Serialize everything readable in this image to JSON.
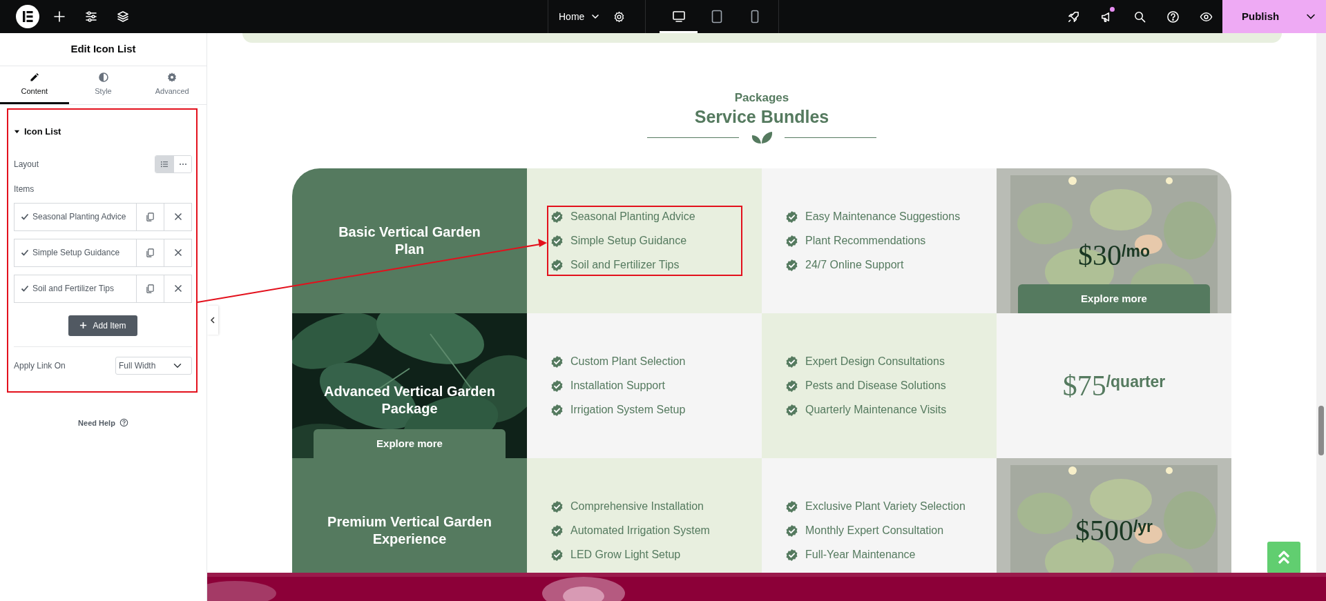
{
  "topbar": {
    "page": "Home",
    "devices": [
      {
        "selected": true
      },
      {
        "selected": false
      },
      {
        "selected": false
      }
    ],
    "has_updates": true,
    "publish": "Publish"
  },
  "panel": {
    "title": "Edit Icon List",
    "tabs": [
      {
        "label": "Content",
        "selected": true
      },
      {
        "label": "Style",
        "selected": false
      },
      {
        "label": "Advanced",
        "selected": false
      }
    ],
    "section": {
      "title": "Icon List",
      "expanded": true,
      "highlighted": true
    },
    "layout": {
      "label": "Layout",
      "options": [
        {
          "kind": "list",
          "selected": true
        },
        {
          "kind": "inline",
          "selected": false
        }
      ]
    },
    "items_label": "Items",
    "items": [
      {
        "text": "Seasonal Planting Advice"
      },
      {
        "text": "Simple Setup Guidance"
      },
      {
        "text": "Soil and Fertilizer Tips"
      }
    ],
    "add_button": "Add Item",
    "link": {
      "label": "Apply Link On",
      "value": "Full Width"
    },
    "help": "Need Help"
  },
  "page": {
    "eyebrow": "Packages",
    "heading": "Service Bundles",
    "packages": [
      {
        "title": {
          "kind": "plain",
          "text": "Basic Vertical Garden\nPlan"
        },
        "features": [
          {
            "highlighted": true,
            "items": [
              "Seasonal Planting Advice",
              "Simple Setup Guidance",
              "Soil and Fertilizer Tips"
            ]
          },
          {
            "highlighted": false,
            "items": [
              "Easy Maintenance Suggestions",
              "Plant Recommendations",
              "24/7 Online Support"
            ]
          }
        ],
        "price": {
          "kind": "picture",
          "amount": "$30",
          "period": "/mo",
          "button": "Explore more"
        }
      },
      {
        "title": {
          "kind": "picture",
          "text": "Advanced Vertical Garden\nPackage",
          "button": "Explore more"
        },
        "features": [
          {
            "highlighted": false,
            "items": [
              "Custom Plant Selection",
              "Installation Support",
              "Irrigation System Setup"
            ]
          },
          {
            "highlighted": false,
            "items": [
              "Expert Design Consultations",
              "Pests and Disease Solutions",
              "Quarterly Maintenance Visits"
            ]
          }
        ],
        "price": {
          "kind": "plain",
          "amount": "$75",
          "period": "/quarter"
        }
      },
      {
        "title": {
          "kind": "plain",
          "text": "Premium Vertical Garden\nExperience"
        },
        "features": [
          {
            "highlighted": false,
            "items": [
              "Comprehensive Installation",
              "Automated Irrigation System",
              "LED Grow Light Setup"
            ]
          },
          {
            "highlighted": false,
            "items": [
              "Exclusive Plant Variety Selection",
              "Monthly Expert Consultation",
              "Full-Year Maintenance"
            ]
          }
        ],
        "price": {
          "kind": "picture",
          "amount": "$500",
          "period": "/yr"
        }
      }
    ]
  }
}
